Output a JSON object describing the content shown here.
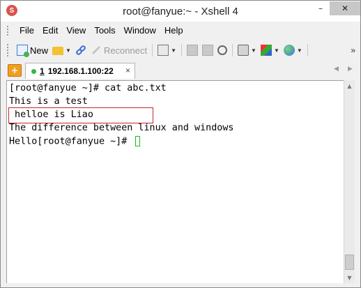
{
  "window": {
    "title": "root@fanyue:~ - Xshell 4",
    "app_icon_glyph": "S"
  },
  "title_controls": {
    "minimize": "–",
    "close": "✕"
  },
  "menu": {
    "items": [
      "File",
      "Edit",
      "View",
      "Tools",
      "Window",
      "Help"
    ]
  },
  "toolbar": {
    "new_label": "New",
    "reconnect_label": "Reconnect",
    "more": "»",
    "icons": [
      "new-session-icon",
      "open-folder-icon",
      "connect-link-icon",
      "reconnect-icon",
      "session-properties-icon",
      "copy-icon",
      "paste-icon",
      "find-icon",
      "print-icon",
      "color-scheme-icon",
      "globe-icon"
    ]
  },
  "tabs": {
    "add_glyph": "+",
    "items": [
      {
        "number": "1",
        "label": "192.168.1.100:22",
        "status": "connected",
        "close": "×"
      }
    ],
    "nav_left": "◀",
    "nav_right": "▶"
  },
  "terminal": {
    "lines": [
      "[root@fanyue ~]# cat abc.txt",
      "This is a test",
      " helloe is Liao",
      "The difference between linux and windows",
      "Hello[root@fanyue ~]# "
    ],
    "highlight_line_index": 2,
    "highlight_color": "#c0282d",
    "cursor_color": "#1db91d"
  },
  "scrollbar": {
    "up": "▲",
    "down": "▼"
  }
}
